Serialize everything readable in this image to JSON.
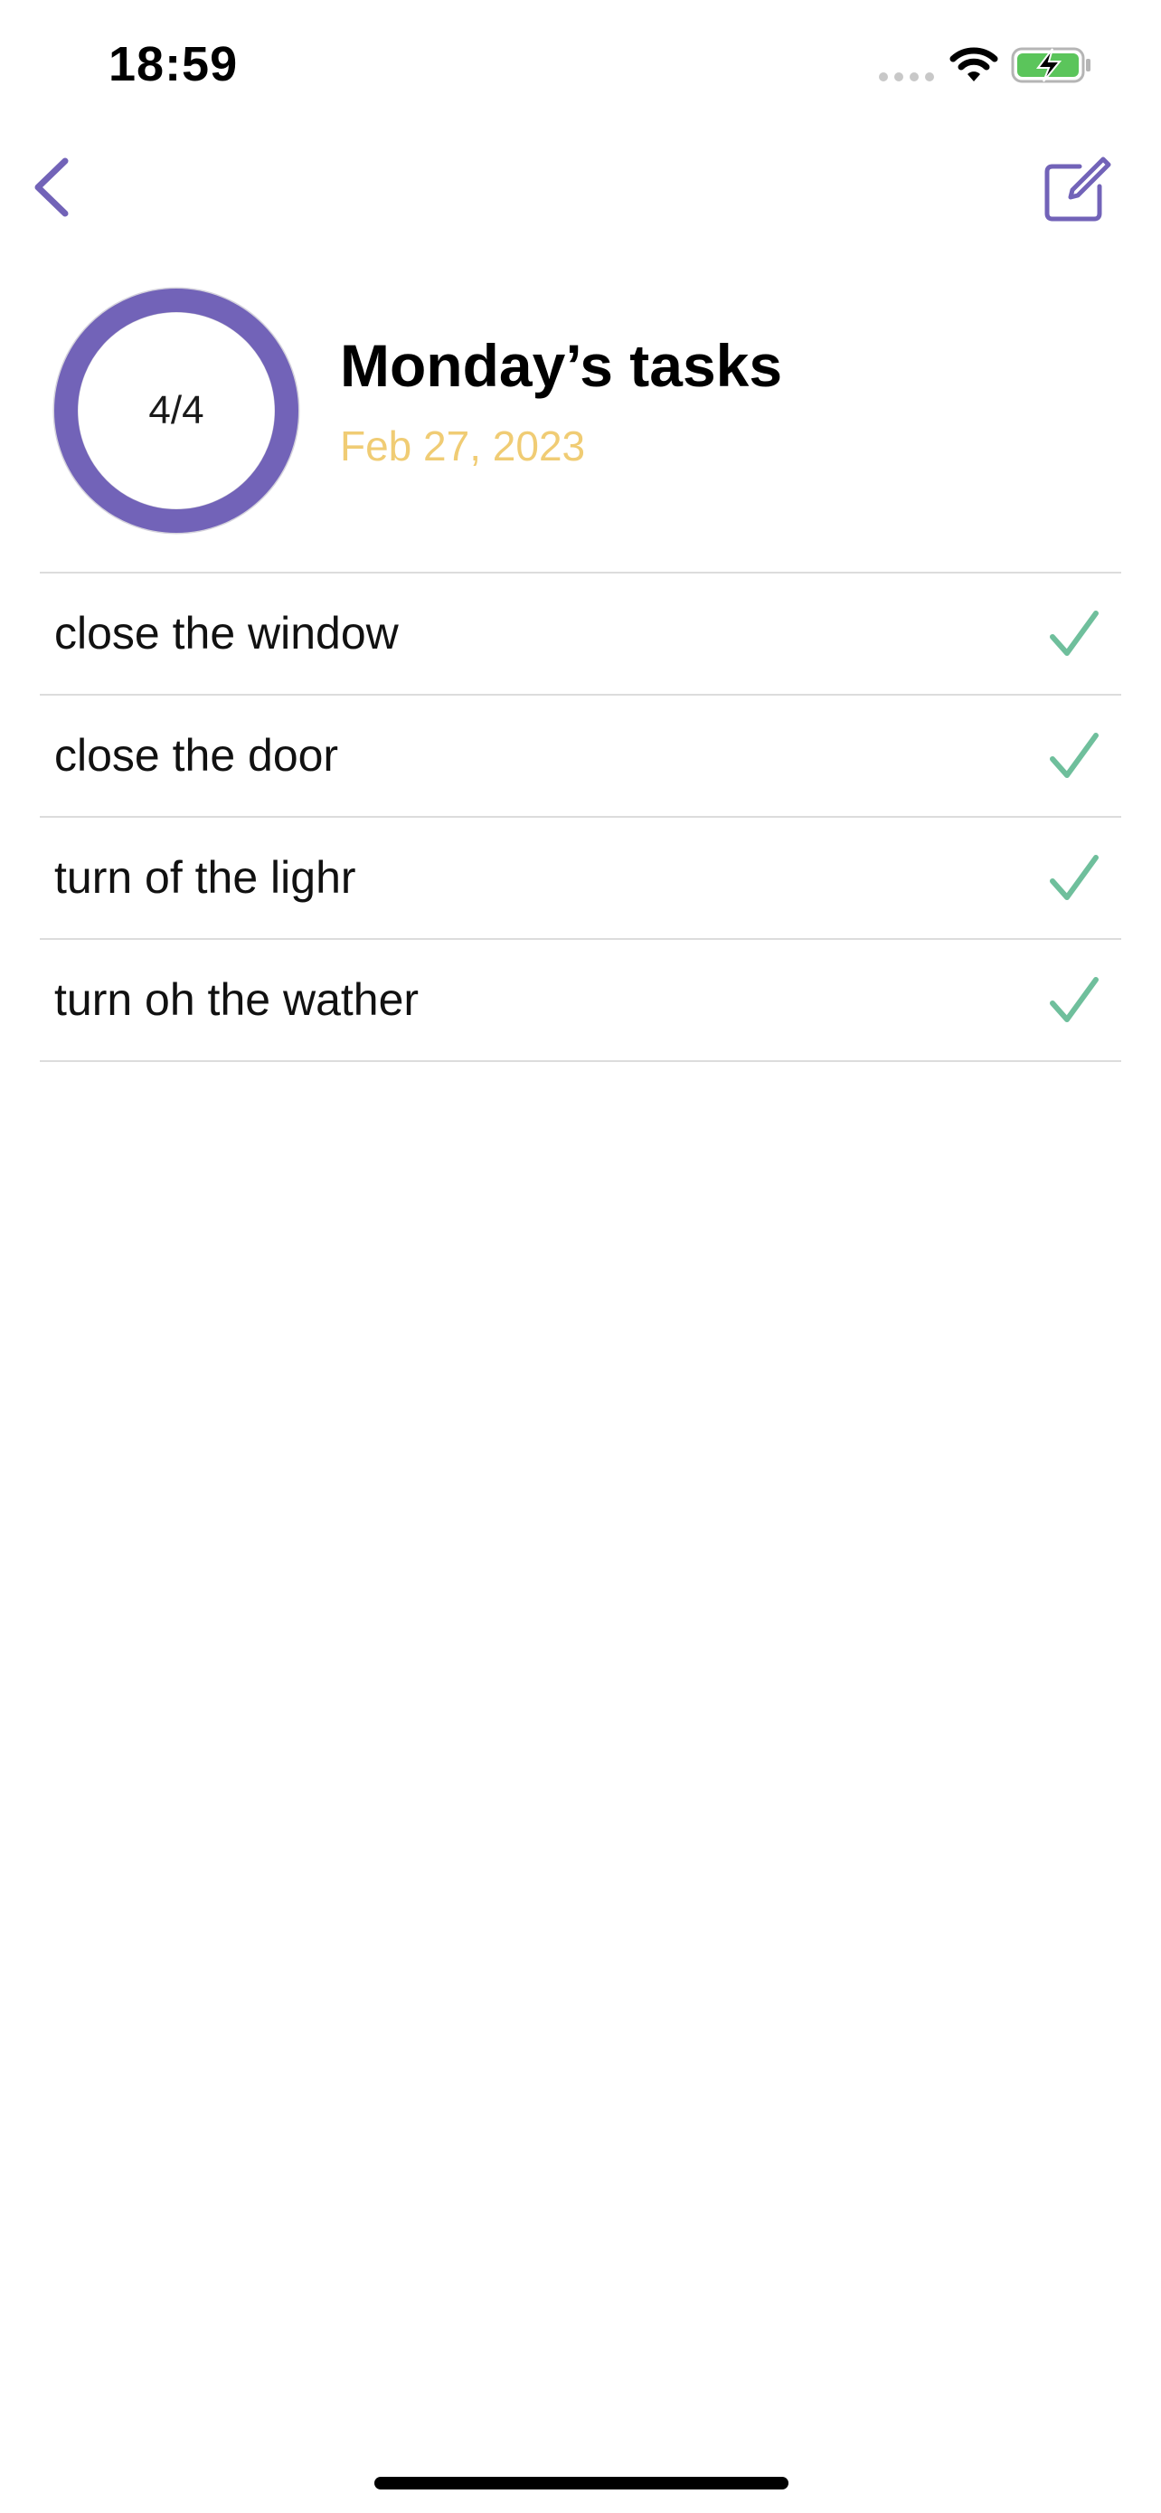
{
  "status_bar": {
    "time": "18:59"
  },
  "nav": {
    "back_icon": "chevron-left-icon",
    "edit_icon": "square-pencil-icon"
  },
  "header": {
    "progress_text": "4/4",
    "progress_fraction": 1.0,
    "title": "Monday’s tasks",
    "date": "Feb 27, 2023"
  },
  "tasks": [
    {
      "label": "close the window",
      "done": true
    },
    {
      "label": "close the door",
      "done": true
    },
    {
      "label": "turn of the lighr",
      "done": true
    },
    {
      "label": "turn oh the wather",
      "done": true
    }
  ],
  "colors": {
    "accent": "#7263b8",
    "ring_track": "#d4d2dc",
    "date": "#f0cc74",
    "check": "#6fbf9c",
    "battery_fill": "#5bc55b"
  }
}
